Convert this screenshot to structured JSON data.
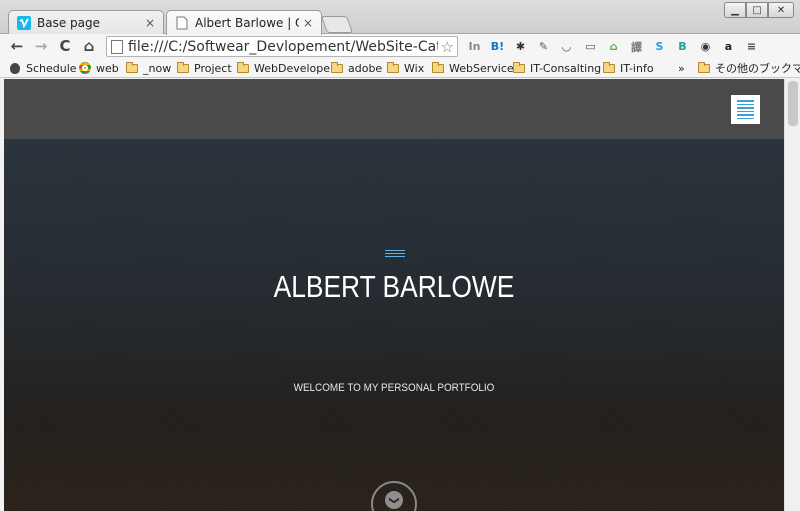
{
  "browser": {
    "tabs": [
      {
        "title": "Base page",
        "icon": "vimeo-icon",
        "close": "×"
      },
      {
        "title": "Albert Barlowe | Onepa",
        "icon": "page-icon",
        "close": "×"
      }
    ],
    "window_controls": {
      "minimize": "▁",
      "maximize": "□",
      "close": "✕"
    },
    "nav": {
      "back": "←",
      "forward": "→",
      "reload": "C",
      "home": "⌂"
    },
    "address": {
      "url": "file:///C:/Softwear_Devlopement/WebSite-Catalo",
      "star": "☆"
    },
    "extensions": [
      {
        "name": "instapaper-icon",
        "label": "In",
        "color": "#888888"
      },
      {
        "name": "hatena-bookmark-icon",
        "label": "B!",
        "color": "#1a73c8"
      },
      {
        "name": "gear-extension-icon",
        "label": "✱",
        "color": "#333333"
      },
      {
        "name": "evernote-icon",
        "label": "✎",
        "color": "#555555"
      },
      {
        "name": "pocket-icon",
        "label": "◡",
        "color": "#555555"
      },
      {
        "name": "cast-icon",
        "label": "▭",
        "color": "#555555"
      },
      {
        "name": "green-extension-icon",
        "label": "⌂",
        "color": "#4caf50"
      },
      {
        "name": "translate-icon",
        "label": "譯",
        "color": "#777777"
      },
      {
        "name": "skype-icon",
        "label": "S",
        "color": "#1da1f2"
      },
      {
        "name": "teal-extension-icon",
        "label": "B",
        "color": "#1aa398"
      },
      {
        "name": "circle-extension-icon",
        "label": "◉",
        "color": "#333333"
      },
      {
        "name": "amazon-icon",
        "label": "a",
        "color": "#222222"
      },
      {
        "name": "chrome-menu-icon",
        "label": "≡",
        "color": "#444444"
      }
    ],
    "bookmarks": [
      {
        "label": "Schedule",
        "type": "apple"
      },
      {
        "label": "web",
        "type": "chrome"
      },
      {
        "label": "_now",
        "type": "folder"
      },
      {
        "label": "Project",
        "type": "folder"
      },
      {
        "label": "WebDeveloper",
        "type": "folder"
      },
      {
        "label": "adobe",
        "type": "folder"
      },
      {
        "label": "Wix",
        "type": "folder"
      },
      {
        "label": "WebService",
        "type": "folder"
      },
      {
        "label": "IT-Consalting",
        "type": "folder"
      },
      {
        "label": "IT-info",
        "type": "folder"
      }
    ],
    "bookmarks_overflow": "»",
    "other_bookmarks": "その他のブックマーク"
  },
  "site": {
    "title": "ALBERT BARLOWE",
    "subtitle": "WELCOME TO MY PERSONAL PORTFOLIO",
    "scroll_icon": "❯",
    "accent_color": "#3aa0d8"
  }
}
